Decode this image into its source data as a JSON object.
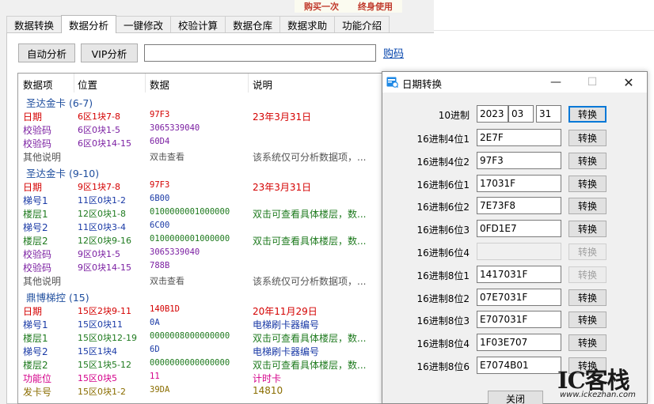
{
  "banner": {
    "left": "购买一次",
    "right": "终身使用"
  },
  "tabs": [
    "数据转换",
    "数据分析",
    "一键修改",
    "校验计算",
    "数据仓库",
    "数据求助",
    "功能介绍"
  ],
  "toolbar": {
    "auto_label": "自动分析",
    "vip_label": "VIP分析",
    "input_value": "",
    "buy_link": "购码"
  },
  "list": {
    "headers": [
      "数据项",
      "位置",
      "数据",
      "说明"
    ],
    "groups": [
      {
        "title": "圣达金卡 (6-7)",
        "rows": [
          {
            "item": "日期",
            "pos": "6区1块7-8",
            "data": "97F3",
            "desc": "23年3月31日",
            "color": "#d40000"
          },
          {
            "item": "校验码",
            "pos": "6区0块1-5",
            "data": "3065339040",
            "desc": "",
            "color": "#7b1fa2"
          },
          {
            "item": "校验码",
            "pos": "6区0块14-15",
            "data": "60D4",
            "desc": "",
            "color": "#7b1fa2"
          },
          {
            "item": "其他说明",
            "pos": "",
            "data": "双击查看",
            "desc": "该系统仅可分析数据项，...",
            "color": "#555555"
          }
        ]
      },
      {
        "title": "圣达金卡 (9-10)",
        "rows": [
          {
            "item": "日期",
            "pos": "9区1块7-8",
            "data": "97F3",
            "desc": "23年3月31日",
            "color": "#d40000"
          },
          {
            "item": "梯号1",
            "pos": "11区0块1-2",
            "data": "6B00",
            "desc": "",
            "color": "#1a3aa6"
          },
          {
            "item": "楼层1",
            "pos": "12区0块1-8",
            "data": "0100000001000000",
            "desc": "双击可查看具体楼层，数...",
            "color": "#1e7a1e"
          },
          {
            "item": "梯号2",
            "pos": "11区0块3-4",
            "data": "6C00",
            "desc": "",
            "color": "#1a3aa6"
          },
          {
            "item": "楼层2",
            "pos": "12区0块9-16",
            "data": "0100000001000000",
            "desc": "双击可查看具体楼层，数...",
            "color": "#1e7a1e"
          },
          {
            "item": "校验码",
            "pos": "9区0块1-5",
            "data": "3065339040",
            "desc": "",
            "color": "#7b1fa2"
          },
          {
            "item": "校验码",
            "pos": "9区0块14-15",
            "data": "788B",
            "desc": "",
            "color": "#7b1fa2"
          },
          {
            "item": "其他说明",
            "pos": "",
            "data": "双击查看",
            "desc": "该系统仅可分析数据项，...",
            "color": "#555555"
          }
        ]
      },
      {
        "title": "鼎博梯控 (15)",
        "rows": [
          {
            "item": "日期",
            "pos": "15区2块9-11",
            "data": "140B1D",
            "desc": "20年11月29日",
            "color": "#d40000"
          },
          {
            "item": "梯号1",
            "pos": "15区0块11",
            "data": "0A",
            "desc": "电梯刷卡器编号",
            "color": "#1a3aa6"
          },
          {
            "item": "楼层1",
            "pos": "15区0块12-19",
            "data": "0000008000000000",
            "desc": "双击可查看具体楼层，数...",
            "color": "#1e7a1e"
          },
          {
            "item": "梯号2",
            "pos": "15区1块4",
            "data": "6D",
            "desc": "电梯刷卡器编号",
            "color": "#1a3aa6"
          },
          {
            "item": "楼层2",
            "pos": "15区1块5-12",
            "data": "0000000000000000",
            "desc": "双击可查看具体楼层，数...",
            "color": "#1e7a1e"
          },
          {
            "item": "功能位",
            "pos": "15区0块5",
            "data": "11",
            "desc": "计时卡",
            "color": "#d4008a"
          },
          {
            "item": "发卡号",
            "pos": "15区0块1-2",
            "data": "39DA",
            "desc": "14810",
            "color": "#8a6d00"
          }
        ]
      }
    ]
  },
  "dialog": {
    "title": "日期转换",
    "close_label": "关闭",
    "convert_label": "转换",
    "dec": {
      "label": "10进制",
      "year": "2023",
      "month": "03",
      "day": "31"
    },
    "rows": [
      {
        "label": "16进制4位1",
        "value": "2E7F",
        "enabled": true
      },
      {
        "label": "16进制4位2",
        "value": "97F3",
        "enabled": true
      },
      {
        "label": "16进制6位1",
        "value": "17031F",
        "enabled": true
      },
      {
        "label": "16进制6位2",
        "value": "7E73F8",
        "enabled": true
      },
      {
        "label": "16进制6位3",
        "value": "0FD1E7",
        "enabled": true
      },
      {
        "label": "16进制6位4",
        "value": "",
        "enabled": false
      },
      {
        "label": "16进制8位1",
        "value": "1417031F",
        "enabled": true,
        "button_disabled": true
      },
      {
        "label": "16进制8位2",
        "value": "07E7031F",
        "enabled": true
      },
      {
        "label": "16进制8位3",
        "value": "E707031F",
        "enabled": true
      },
      {
        "label": "16进制8位4",
        "value": "1F03E707",
        "enabled": true
      },
      {
        "label": "16进制8位6",
        "value": "E7074B01",
        "enabled": true
      }
    ]
  },
  "watermark": {
    "logo": "IC客栈",
    "url": "www.ickezhan.com"
  }
}
